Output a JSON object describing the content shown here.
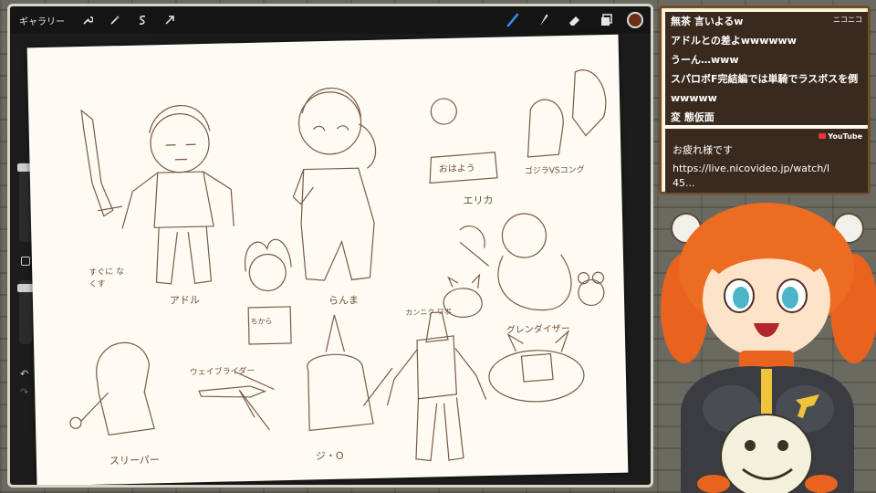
{
  "toolbar": {
    "gallery_label": "ギャラリー",
    "left_icons": [
      "wrench-icon",
      "magic-wand-icon",
      "selection-icon",
      "move-arrow-icon"
    ],
    "right_tools": [
      "brush-icon",
      "smudge-icon",
      "eraser-icon",
      "layers-icon"
    ],
    "active_tool": "brush-icon",
    "current_color": "#6a2f14"
  },
  "sketch": {
    "labels": {
      "adol": "アドル",
      "adol_note": "すぐに なくす",
      "ranma": "らんま",
      "erika": "エリカ",
      "ohayou": "おはよう",
      "godzilla_vs_kong": "ゴジラVSコング",
      "sleeper": "スリーパー",
      "wave_rider": "ウェイブライダー",
      "zero": "ジ・O",
      "kanniku": "カンニク ワボ",
      "grendizer": "グレンダイザー",
      "shirt_text": "ちから"
    }
  },
  "chat": {
    "nico_badge": "ニコニコ",
    "nico_lines": [
      "無茶 言いよるw",
      "アドルとの差よwwwwww",
      "うーん…www",
      "スパロボF完結編では単騎でラスボスを倒",
      "wwwww",
      "変 態仮面"
    ],
    "yt_badge": "YouTube",
    "yt_lines": [
      "お疲れ様です",
      "https://live.nicovideo.jp/watch/l",
      "45..."
    ]
  },
  "colors": {
    "ink": "#6e4e3a",
    "chat_border": "#6f4d2c",
    "chat_bg": "#3a2a1e",
    "avatar_hair": "#e8631e"
  }
}
